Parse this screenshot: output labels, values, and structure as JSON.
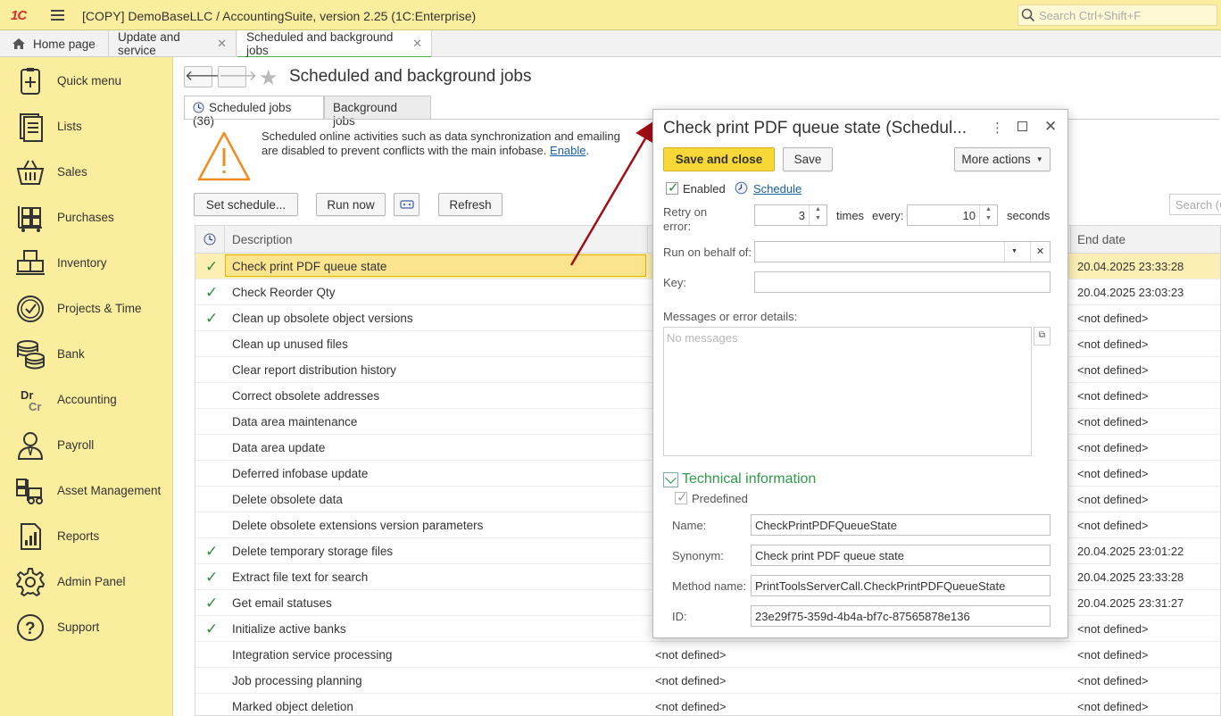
{
  "titlebar": {
    "logo": "1С",
    "title": "[COPY] DemoBaseLLC / AccountingSuite, version 2.25  (1C:Enterprise)",
    "search_placeholder": "Search Ctrl+Shift+F"
  },
  "tabs": [
    {
      "label": "Home page"
    },
    {
      "label": "Update and service"
    },
    {
      "label": "Scheduled and background jobs"
    }
  ],
  "sidebar": {
    "items": [
      {
        "label": "Quick menu",
        "icon": "quick-menu-icon"
      },
      {
        "label": "Lists",
        "icon": "lists-icon"
      },
      {
        "label": "Sales",
        "icon": "basket-icon"
      },
      {
        "label": "Purchases",
        "icon": "cart-icon"
      },
      {
        "label": "Inventory",
        "icon": "boxes-icon"
      },
      {
        "label": "Projects & Time",
        "icon": "clock-icon"
      },
      {
        "label": "Bank",
        "icon": "coins-icon"
      },
      {
        "label": "Accounting",
        "icon": "dr-cr-icon"
      },
      {
        "label": "Payroll",
        "icon": "person-icon"
      },
      {
        "label": "Asset Management",
        "icon": "forklift-icon"
      },
      {
        "label": "Reports",
        "icon": "report-icon"
      },
      {
        "label": "Admin Panel",
        "icon": "gear-icon"
      },
      {
        "label": "Support",
        "icon": "question-icon"
      }
    ]
  },
  "page": {
    "title": "Scheduled and background jobs",
    "tab_scheduled": "Scheduled jobs (36)",
    "tab_background": "Background jobs",
    "warning_text": "Scheduled online activities such as data synchronization and emailing are disabled to prevent conflicts with the main infobase.",
    "warning_link": "Enable",
    "warning_period": ".",
    "buttons": {
      "set_schedule": "Set schedule...",
      "run_now": "Run now",
      "refresh": "Refresh"
    },
    "table_search": "Search (C",
    "columns": {
      "description": "Description",
      "end_date": "End date"
    },
    "rows": [
      {
        "checked": true,
        "description": "Check print PDF queue state",
        "schedule": "",
        "end": "20.04.2025 23:33:28"
      },
      {
        "checked": true,
        "description": "Check Reorder Qty",
        "schedule": "",
        "end": "20.04.2025 23:03:23"
      },
      {
        "checked": true,
        "description": "Clean up obsolete object versions",
        "schedule": "",
        "end": "<not defined>"
      },
      {
        "checked": false,
        "description": "Clean up unused files",
        "schedule": "",
        "end": "<not defined>"
      },
      {
        "checked": false,
        "description": "Clear report distribution history",
        "schedule": "",
        "end": "<not defined>"
      },
      {
        "checked": false,
        "description": "Correct obsolete addresses",
        "schedule": "",
        "end": "<not defined>"
      },
      {
        "checked": false,
        "description": "Data area maintenance",
        "schedule": "",
        "end": "<not defined>"
      },
      {
        "checked": false,
        "description": "Data area update",
        "schedule": "",
        "end": "<not defined>"
      },
      {
        "checked": false,
        "description": "Deferred infobase update",
        "schedule": "",
        "end": "<not defined>"
      },
      {
        "checked": false,
        "description": "Delete obsolete data",
        "schedule": "",
        "end": "<not defined>"
      },
      {
        "checked": false,
        "description": "Delete obsolete extensions version parameters",
        "schedule": "",
        "end": "<not defined>"
      },
      {
        "checked": true,
        "description": "Delete temporary storage files",
        "schedule": "",
        "end": "20.04.2025 23:01:22"
      },
      {
        "checked": true,
        "description": "Extract file text for search",
        "schedule": "",
        "end": "20.04.2025 23:33:28"
      },
      {
        "checked": true,
        "description": "Get email statuses",
        "schedule": "",
        "end": "20.04.2025 23:31:27"
      },
      {
        "checked": true,
        "description": "Initialize active banks",
        "schedule": "",
        "end": "<not defined>"
      },
      {
        "checked": false,
        "description": "Integration service processing",
        "schedule": "<not defined>",
        "end": "<not defined>"
      },
      {
        "checked": false,
        "description": "Job processing planning",
        "schedule": "<not defined>",
        "end": "<not defined>"
      },
      {
        "checked": false,
        "description": "Marked object deletion",
        "schedule": "<not defined>",
        "end": "<not defined>"
      }
    ]
  },
  "dialog": {
    "title": "Check print PDF queue state (Schedul...",
    "save_close": "Save and close",
    "save": "Save",
    "more_actions": "More actions",
    "enabled_label": "Enabled",
    "schedule_link": "Schedule",
    "retry_label": "Retry on error:",
    "retry_value": "3",
    "times_label": "times",
    "every_label": "every:",
    "every_value": "10",
    "seconds_label": "seconds",
    "run_on_behalf_label": "Run on behalf of:",
    "run_on_behalf_value": "",
    "key_label": "Key:",
    "key_value": "",
    "messages_label": "Messages or error details:",
    "messages_placeholder": "No messages",
    "tech_info": "Technical information",
    "predefined_label": "Predefined",
    "name_label": "Name:",
    "name_value": "CheckPrintPDFQueueState",
    "synonym_label": "Synonym:",
    "synonym_value": "Check print PDF queue state",
    "method_label": "Method name:",
    "method_value": "PrintToolsServerCall.CheckPrintPDFQueueState",
    "id_label": "ID:",
    "id_value": "23e29f75-359d-4b4a-bf7c-87565878e136"
  }
}
